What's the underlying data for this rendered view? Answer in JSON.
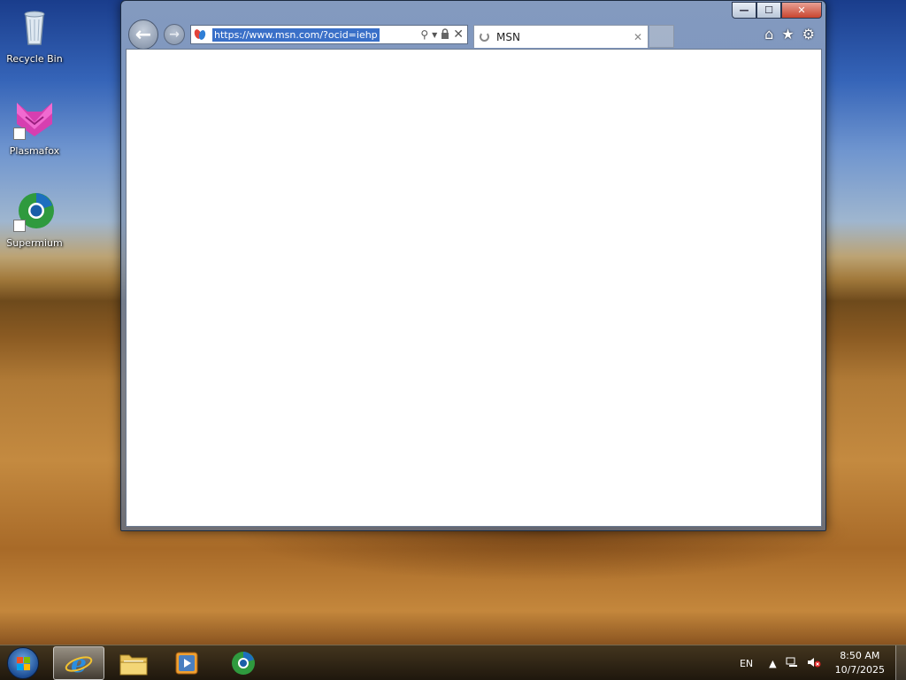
{
  "desktop": {
    "icons": [
      {
        "label": "Recycle Bin"
      },
      {
        "label": "Plasmafox"
      },
      {
        "label": "Supermium"
      }
    ]
  },
  "browser": {
    "address": "https://www.msn.com/?ocid=iehp",
    "tab_title": "MSN",
    "caption": {
      "minimize": "—",
      "maximize": "☐",
      "close": "✕"
    }
  },
  "taskbar": {
    "language": "EN",
    "clock_time": "8:50 AM",
    "clock_date": "10/7/2025"
  },
  "colors": {
    "selection": "#3a70c8",
    "close_button": "#c8452f"
  }
}
